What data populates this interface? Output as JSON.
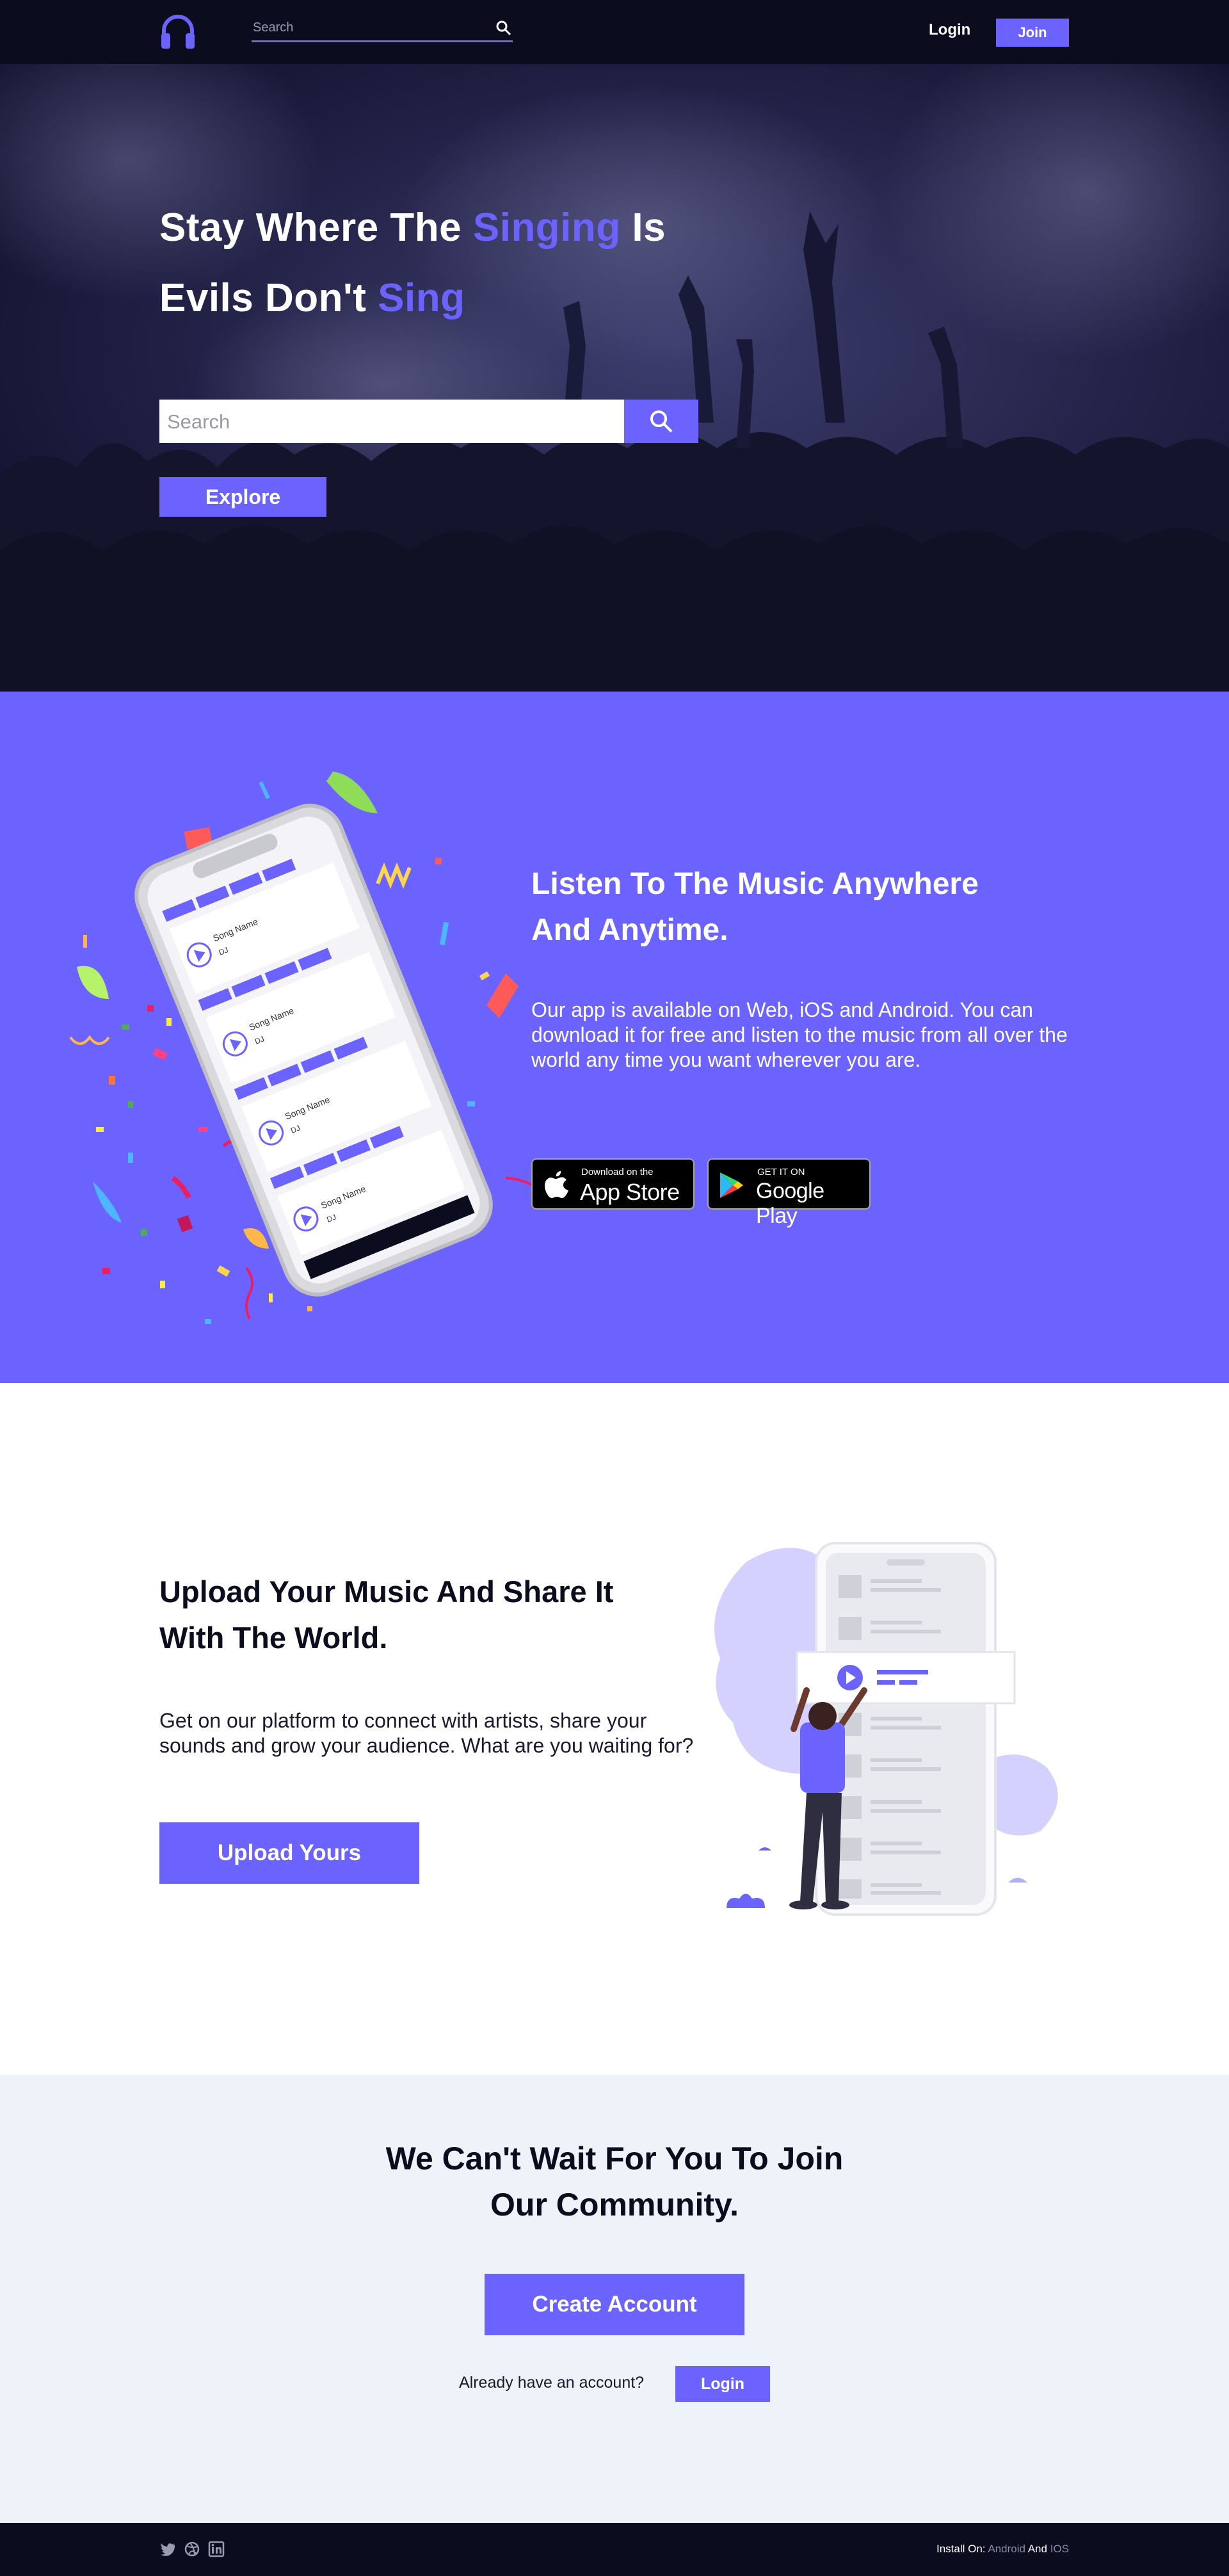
{
  "nav": {
    "search_placeholder": "Search",
    "login": "Login",
    "join": "Join"
  },
  "hero": {
    "line1_a": "Stay Where The ",
    "line1_accent": "Singing",
    "line1_b": " Is",
    "line2_a": "Evils Don't ",
    "line2_accent": "Sing",
    "search_placeholder": "Search",
    "explore": "Explore"
  },
  "app": {
    "title_line1": "Listen To The Music Anywhere",
    "title_line2": "And Anytime.",
    "description": "Our app is available on Web, iOS and Android. You can download it for free and listen to the music from all over the world any time you want wherever you are.",
    "apple_small": "Download on the",
    "apple_big": "App Store",
    "google_small": "GET IT ON",
    "google_big": "Google Play",
    "song_label": "Song Name",
    "artist_label": "DJ"
  },
  "upload": {
    "title_line1": "Upload Your Music And Share It",
    "title_line2": "With The World.",
    "description": "Get on our platform to connect with artists, share your sounds and grow your audience. What are you waiting for?",
    "button": "Upload Yours"
  },
  "community": {
    "title_line1": "We Can't Wait For You To Join",
    "title_line2": "Our Community.",
    "create": "Create Account",
    "already": "Already have an account?",
    "login": "Login"
  },
  "footer": {
    "install_prefix": "Install On: ",
    "android": "Android",
    "and": " And ",
    "ios": "IOS",
    "social": [
      "twitter-icon",
      "dribbble-icon",
      "linkedin-icon"
    ]
  },
  "colors": {
    "accent": "#6c63ff",
    "dark": "#0c0c1f",
    "light_bg": "#eef2f9"
  }
}
